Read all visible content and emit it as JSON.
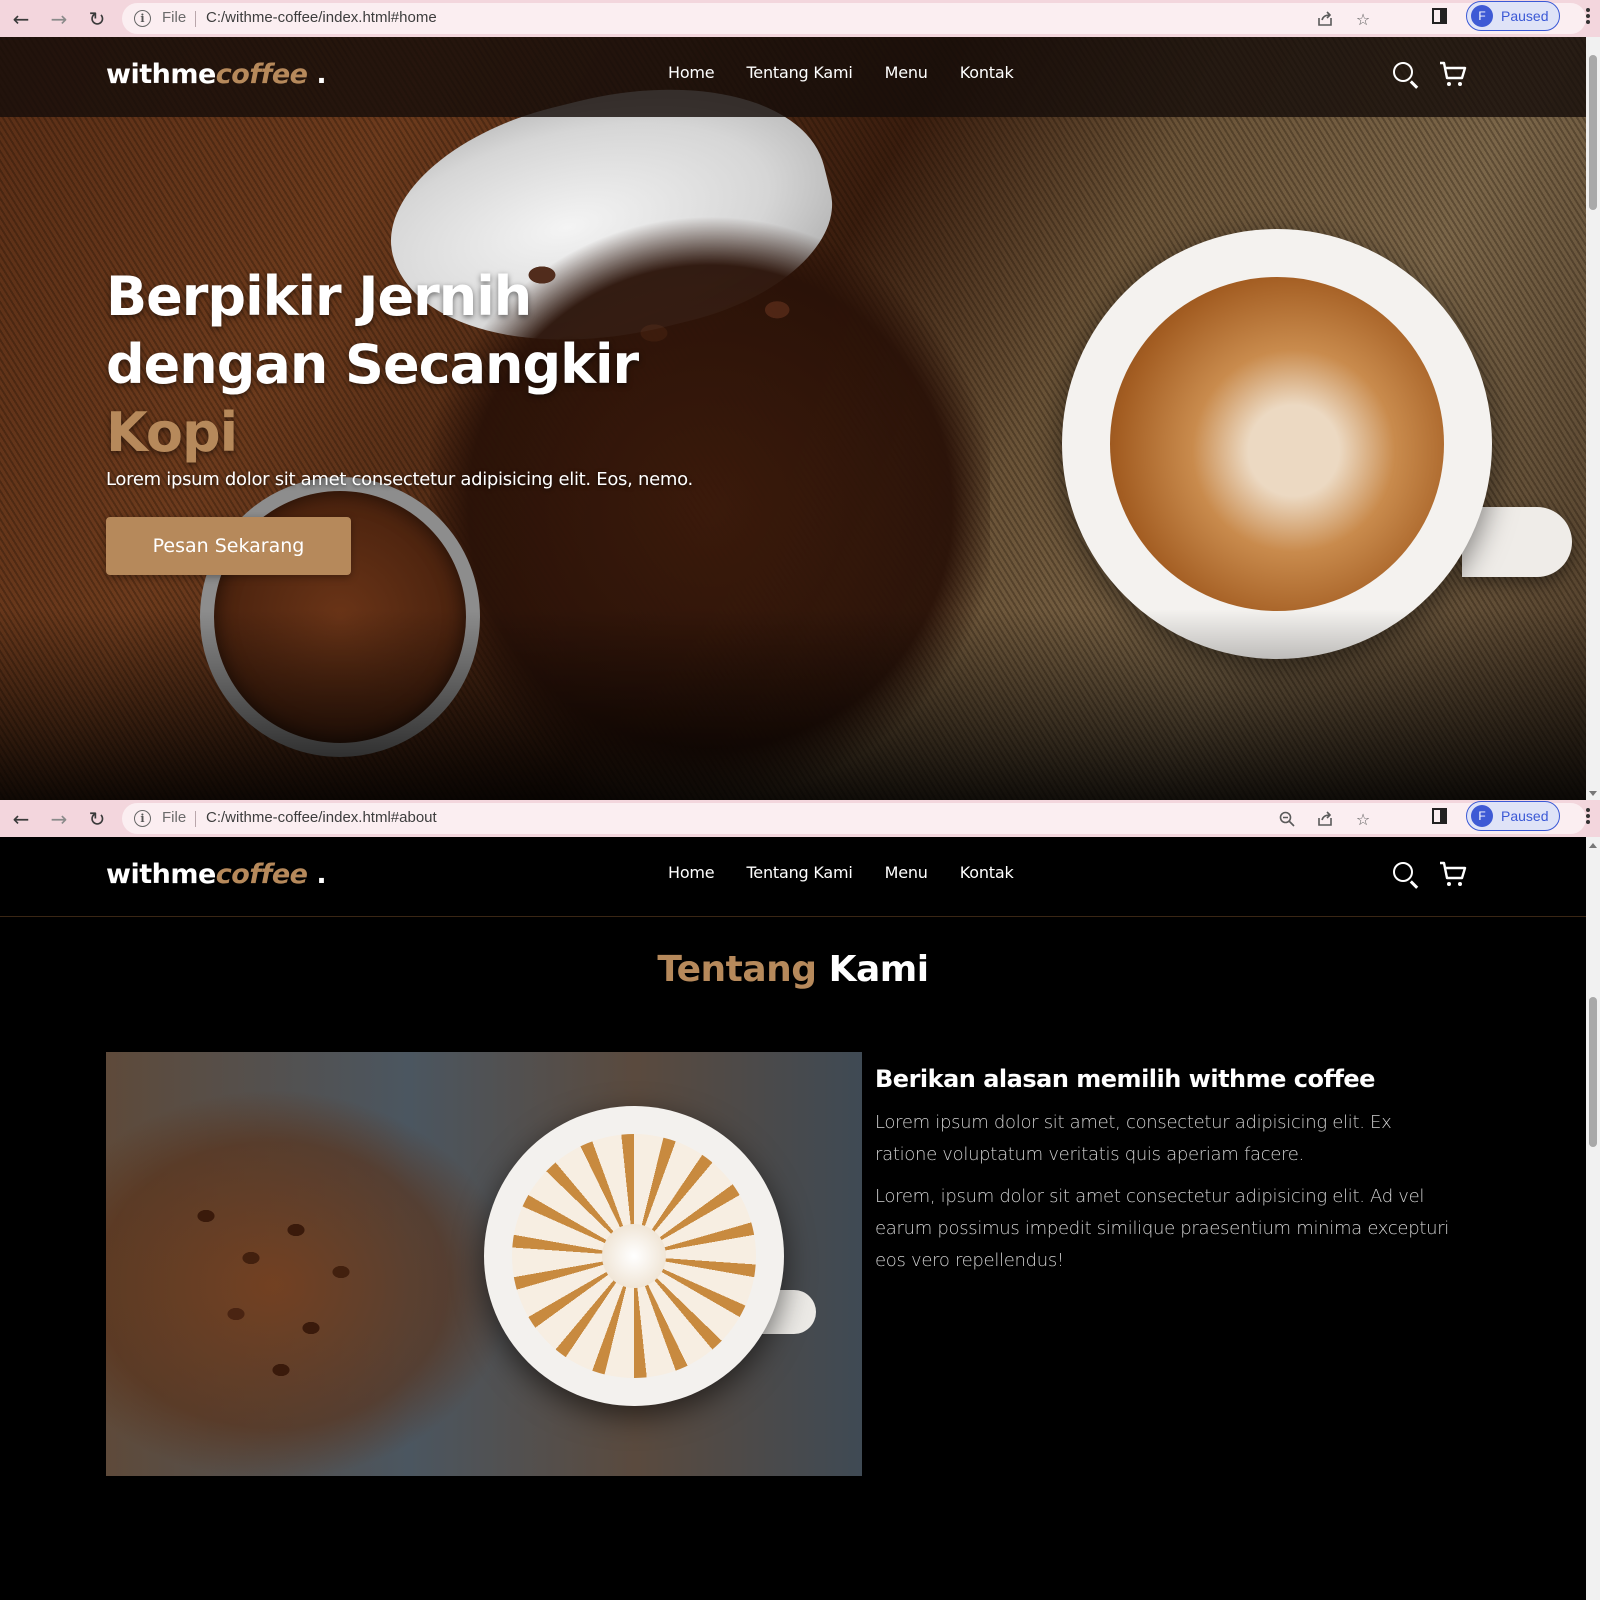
{
  "screens": [
    {
      "browser": {
        "file_label": "File",
        "url": "C:/withme-coffee/index.html#home",
        "profile_initial": "F",
        "profile_status": "Paused"
      }
    },
    {
      "browser": {
        "file_label": "File",
        "url": "C:/withme-coffee/index.html#about",
        "profile_initial": "F",
        "profile_status": "Paused"
      }
    }
  ],
  "site": {
    "logo_main": "withme",
    "logo_accent": "coffee",
    "logo_dot": " .",
    "nav": [
      "Home",
      "Tentang Kami",
      "Menu",
      "Kontak"
    ]
  },
  "hero": {
    "title_line1": "Berpikir Jernih",
    "title_line2": "dengan Secangkir",
    "title_accent": "Kopi",
    "subtitle": "Lorem ipsum dolor sit amet consectetur adipisicing elit. Eos, nemo.",
    "cta": "Pesan Sekarang"
  },
  "about": {
    "title_accent": "Tentang",
    "title_main": "Kami",
    "heading": "Berikan alasan memilih withme coffee",
    "paragraphs": [
      "Lorem ipsum dolor sit amet, consectetur adipisicing elit. Ex ratione voluptatum veritatis quis aperiam facere.",
      "Lorem, ipsum dolor sit amet consectetur adipisicing elit. Ad vel earum possimus impedit similique praesentium minima excepturi eos vero repellendus!"
    ]
  },
  "colors": {
    "accent": "#b6895b",
    "chrome_bg": "#f3d6dd",
    "profile_blue": "#3b59d6"
  },
  "icons": [
    "back-arrow-icon",
    "forward-arrow-icon",
    "reload-icon",
    "info-icon",
    "zoom-icon",
    "share-icon",
    "star-icon",
    "side-panel-icon",
    "kebab-menu-icon",
    "search-icon",
    "cart-icon"
  ]
}
